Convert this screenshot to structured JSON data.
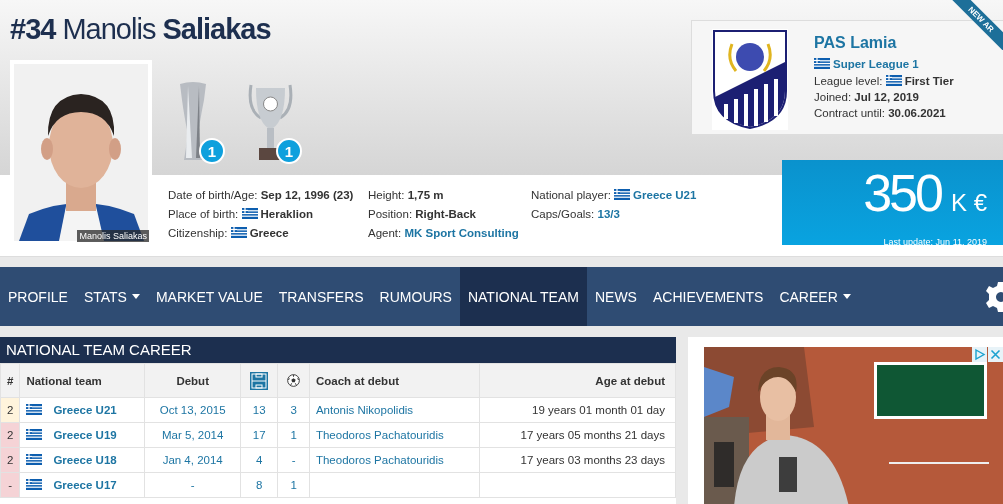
{
  "player": {
    "number": "#34",
    "first_name": "Manolis",
    "last_name": "Saliakas",
    "photo_caption": "Manolis Saliakas"
  },
  "trophies": [
    {
      "kind": "tall",
      "count": "1"
    },
    {
      "kind": "cup",
      "count": "1"
    }
  ],
  "info_columns": [
    [
      {
        "label": "Date of birth/Age:",
        "value": "Sep 12, 1996 (23)",
        "flag": false,
        "link": false
      },
      {
        "label": "Place of birth:",
        "value": "Heraklion",
        "flag": true,
        "link": false
      },
      {
        "label": "Citizenship:",
        "value": "Greece",
        "flag": true,
        "link": false
      }
    ],
    [
      {
        "label": "Height:",
        "value": "1,75 m",
        "flag": false,
        "link": false
      },
      {
        "label": "Position:",
        "value": "Right-Back",
        "flag": false,
        "link": false
      },
      {
        "label": "Agent:",
        "value": "MK Sport Consulting",
        "flag": false,
        "link": true
      }
    ],
    [
      {
        "label": "National player:",
        "value": "Greece U21",
        "flag": true,
        "link": true
      },
      {
        "label": "Caps/Goals:",
        "value": "13/3",
        "flag": false,
        "link": true
      }
    ]
  ],
  "club": {
    "name": "PAS Lamia",
    "league": "Super League 1",
    "ribbon": "NEW AR",
    "facts": [
      {
        "label": "League level:",
        "value": "First Tier",
        "flag": true
      },
      {
        "label": "Joined:",
        "value": "Jul 12, 2019",
        "flag": false
      },
      {
        "label": "Contract until:",
        "value": "30.06.2021",
        "flag": false
      }
    ]
  },
  "market_value": {
    "amount": "350",
    "unit": "K €",
    "updated": "Last update: Jun 11, 2019"
  },
  "nav": {
    "tabs": [
      {
        "label": "PROFILE",
        "selected": false,
        "dropdown": false
      },
      {
        "label": "STATS",
        "selected": false,
        "dropdown": true
      },
      {
        "label": "MARKET VALUE",
        "selected": false,
        "dropdown": false
      },
      {
        "label": "TRANSFERS",
        "selected": false,
        "dropdown": false
      },
      {
        "label": "RUMOURS",
        "selected": false,
        "dropdown": false
      },
      {
        "label": "NATIONAL TEAM",
        "selected": true,
        "dropdown": false
      },
      {
        "label": "NEWS",
        "selected": false,
        "dropdown": false
      },
      {
        "label": "ACHIEVEMENTS",
        "selected": false,
        "dropdown": false
      },
      {
        "label": "CAREER",
        "selected": false,
        "dropdown": true
      }
    ]
  },
  "table": {
    "title": "NATIONAL TEAM CAREER",
    "columns": [
      {
        "kind": "text",
        "label": "#"
      },
      {
        "kind": "text",
        "label": "National team"
      },
      {
        "kind": "text",
        "label": "Debut"
      },
      {
        "kind": "pitch"
      },
      {
        "kind": "ball"
      },
      {
        "kind": "text",
        "label": "Coach at debut"
      },
      {
        "kind": "text",
        "label": "Age at debut"
      }
    ],
    "rows": [
      {
        "rank": "2",
        "color": "#fff4dc",
        "team": "Greece U21",
        "debut": "Oct 13, 2015",
        "apps": "13",
        "goals": "3",
        "coach": "Antonis Nikopolidis",
        "age": "19 years 01 month 01 day"
      },
      {
        "rank": "2",
        "color": "#f5d3d6",
        "team": "Greece U19",
        "debut": "Mar 5, 2014",
        "apps": "17",
        "goals": "1",
        "coach": "Theodoros Pachatouridis",
        "age": "17 years 05 months 21 days"
      },
      {
        "rank": "2",
        "color": "#f5d3d6",
        "team": "Greece U18",
        "debut": "Jan 4, 2014",
        "apps": "4",
        "goals": "-",
        "coach": "Theodoros Pachatouridis",
        "age": "17 years 03 months 23 days"
      },
      {
        "rank": "-",
        "color": "#f5d3d6",
        "team": "Greece U17",
        "debut": "-",
        "apps": "8",
        "goals": "1"
      }
    ]
  },
  "ad": {
    "kind": "picture"
  }
}
